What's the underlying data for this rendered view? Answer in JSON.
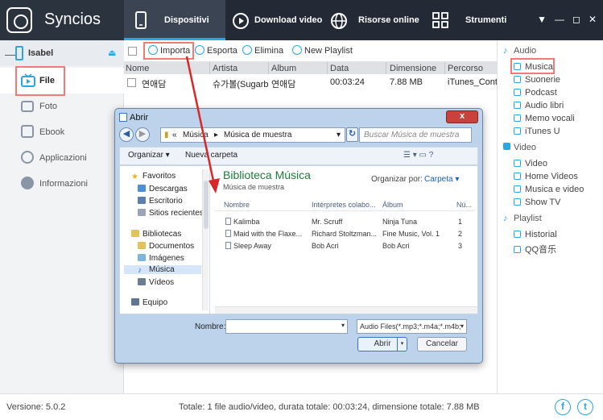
{
  "app": {
    "name": "Syncios"
  },
  "nav_tabs": [
    {
      "label": "Dispositivi"
    },
    {
      "label": "Download video"
    },
    {
      "label": "Risorse online"
    },
    {
      "label": "Strumenti"
    }
  ],
  "window_controls": [
    "▼",
    "—",
    "◻",
    "✕"
  ],
  "device": {
    "name": "Isabel",
    "collapse": "—",
    "eject": "⏏"
  },
  "sidebar": {
    "items": [
      {
        "label": "File"
      },
      {
        "label": "Foto"
      },
      {
        "label": "Ebook"
      },
      {
        "label": "Applicazioni"
      },
      {
        "label": "Informazioni"
      }
    ]
  },
  "toolbar": {
    "import": "Importa",
    "export": "Esporta",
    "delete": "Elimina",
    "new_playlist": "New Playlist"
  },
  "table": {
    "columns": [
      "Nome",
      "Artista",
      "Album",
      "Data",
      "Dimensione",
      "Percorso"
    ],
    "rows": [
      {
        "name": "연애담",
        "artist": "슈가볼(Sugarb...",
        "album": "연애담",
        "date": "00:03:24",
        "size": "7.88 MB",
        "path": "iTunes_Contr"
      }
    ]
  },
  "right_panel": {
    "audio": {
      "title": "Audio",
      "items": [
        "Musica",
        "Suonerie",
        "Podcast",
        "Audio libri",
        "Memo vocali",
        "iTunes U"
      ]
    },
    "video": {
      "title": "Video",
      "items": [
        "Video",
        "Home Videos",
        "Musica e video",
        "Show TV"
      ]
    },
    "playlist": {
      "title": "Playlist",
      "items": [
        "Historial",
        "QQ音乐"
      ]
    }
  },
  "status": {
    "version": "Versione: 5.0.2",
    "totals": "Totale: 1 file audio/video, durata totale: 00:03:24, dimensione totale: 7.88 MB",
    "facebook_glyph": "f",
    "twitter_glyph": "t"
  },
  "dialog": {
    "title": "Abrir",
    "close": "x",
    "back": "◀",
    "forward": "▶",
    "path_prefix": "«",
    "path_1": "Música",
    "path_sep": "▸",
    "path_2": "Música de muestra",
    "path_dropdown": "▾",
    "refresh": "↻",
    "search_placeholder": "Buscar Música de muestra",
    "organize": "Organizar ▾",
    "new_folder": "Nueva carpeta",
    "view_icons": "☰ ▾  ▭  ?",
    "tree": [
      "Favoritos",
      "Descargas",
      "Escritorio",
      "Sitios recientes",
      "Bibliotecas",
      "Documentos",
      "Imágenes",
      "Música",
      "Vídeos",
      "Equipo"
    ],
    "library_title": "Biblioteca Música",
    "library_subtitle": "Música de muestra",
    "organize_by": "Organizar por:",
    "organize_by_value": "Carpeta ▾",
    "columns": [
      "Nombre",
      "Intérpretes colabo...",
      "Álbum",
      "Nú..."
    ],
    "files": [
      {
        "name": "Kalimba",
        "artist": "Mr. Scruff",
        "album": "Ninja Tuna",
        "num": "1"
      },
      {
        "name": "Maid with the Flaxe...",
        "artist": "Richard Stoltzman...",
        "album": "Fine Music, Vol. 1",
        "num": "2"
      },
      {
        "name": "Sleep Away",
        "artist": "Bob Acri",
        "album": "Bob Acri",
        "num": "3"
      }
    ],
    "name_label": "Nombre:",
    "name_dropdown": "▾",
    "filter": "Audio Files(*.mp3;*.m4a;*.m4b;",
    "filter_dropdown": "▾",
    "open": "Abrir",
    "open_split": "▾",
    "cancel": "Cancelar"
  },
  "colors": {
    "accent": "#28a7e0",
    "highlight": "#f47a7a",
    "arrow": "#d62828",
    "titlebar": "#232a35"
  }
}
